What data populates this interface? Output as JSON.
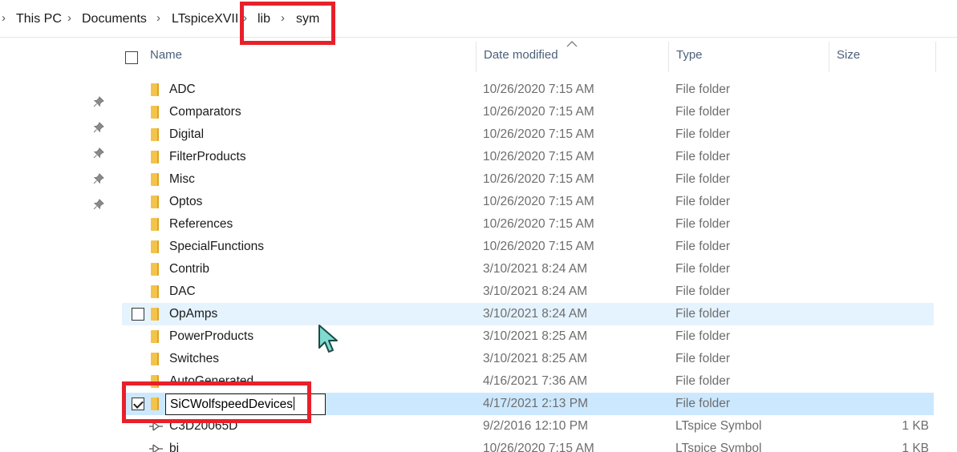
{
  "breadcrumb": {
    "items": [
      "This PC",
      "Documents",
      "LTspiceXVII",
      "lib",
      "sym"
    ]
  },
  "columns": {
    "name": "Name",
    "date_modified": "Date modified",
    "type": "Type",
    "size": "Size"
  },
  "rows": [
    {
      "name": "ADC",
      "date": "10/26/2020 7:15 AM",
      "type": "File folder",
      "size": ""
    },
    {
      "name": "Comparators",
      "date": "10/26/2020 7:15 AM",
      "type": "File folder",
      "size": ""
    },
    {
      "name": "Digital",
      "date": "10/26/2020 7:15 AM",
      "type": "File folder",
      "size": ""
    },
    {
      "name": "FilterProducts",
      "date": "10/26/2020 7:15 AM",
      "type": "File folder",
      "size": ""
    },
    {
      "name": "Misc",
      "date": "10/26/2020 7:15 AM",
      "type": "File folder",
      "size": ""
    },
    {
      "name": "Optos",
      "date": "10/26/2020 7:15 AM",
      "type": "File folder",
      "size": ""
    },
    {
      "name": "References",
      "date": "10/26/2020 7:15 AM",
      "type": "File folder",
      "size": ""
    },
    {
      "name": "SpecialFunctions",
      "date": "10/26/2020 7:15 AM",
      "type": "File folder",
      "size": ""
    },
    {
      "name": "Contrib",
      "date": "3/10/2021 8:24 AM",
      "type": "File folder",
      "size": ""
    },
    {
      "name": "DAC",
      "date": "3/10/2021 8:24 AM",
      "type": "File folder",
      "size": ""
    },
    {
      "name": "OpAmps",
      "date": "3/10/2021 8:24 AM",
      "type": "File folder",
      "size": ""
    },
    {
      "name": "PowerProducts",
      "date": "3/10/2021 8:25 AM",
      "type": "File folder",
      "size": ""
    },
    {
      "name": "Switches",
      "date": "3/10/2021 8:25 AM",
      "type": "File folder",
      "size": ""
    },
    {
      "name": "AutoGenerated",
      "date": "4/16/2021 7:36 AM",
      "type": "File folder",
      "size": ""
    },
    {
      "name": "SiCWolfspeedDevices",
      "date": "4/17/2021 2:13 PM",
      "type": "File folder",
      "size": ""
    },
    {
      "name": "C3D20065D",
      "date": "9/2/2016 12:10 PM",
      "type": "LTspice Symbol",
      "size": "1 KB"
    },
    {
      "name": "bi",
      "date": "10/26/2020 7:15 AM",
      "type": "LTspice Symbol",
      "size": "1 KB"
    }
  ],
  "rename": {
    "value": "SiCWolfspeedDevices"
  },
  "colors": {
    "highlight_box": "#e8202a",
    "selected_row": "#cce8ff",
    "hover_row": "#e5f3ff",
    "folder": "#f3c34b"
  }
}
